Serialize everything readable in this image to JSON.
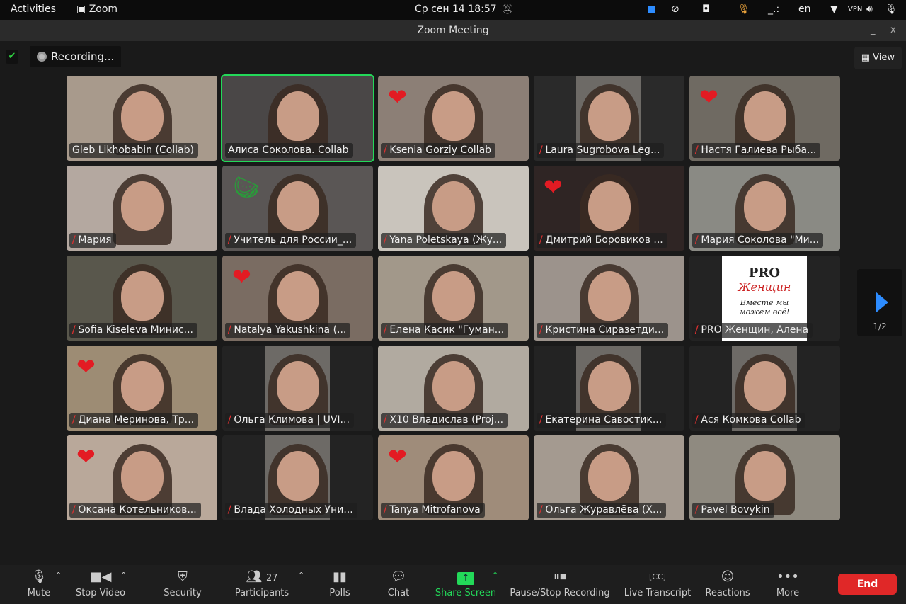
{
  "system_bar": {
    "activities": "Activities",
    "app": "Zoom",
    "datetime": "Ср сен 14  18:57",
    "lang": "en"
  },
  "window": {
    "title": "Zoom Meeting",
    "minimize": "_",
    "close": "x"
  },
  "meeting": {
    "recording": "Recording...",
    "view": "View",
    "page": "1/2"
  },
  "participants": [
    {
      "name": "Gleb Likhobabin (Collab)",
      "muted": false,
      "heart": false,
      "bg": "#a89a8c"
    },
    {
      "name": "Алиса Соколова. Collab",
      "muted": false,
      "heart": false,
      "bg": "#4a4747",
      "active": true
    },
    {
      "name": "Ksenia Gorziy Collab",
      "muted": true,
      "heart": true,
      "bg": "#8c7f76"
    },
    {
      "name": "Laura Sugrobova Leg...",
      "muted": true,
      "heart": false,
      "bg": "#2a2a2a"
    },
    {
      "name": "Настя Галиева Рыба...",
      "muted": true,
      "heart": true,
      "bg": "#6f6a62"
    },
    {
      "name": "Мария",
      "muted": true,
      "heart": false,
      "bg": "#b4a8a0"
    },
    {
      "name": "Учитель для России_...",
      "muted": true,
      "heart": false,
      "watermelon": true,
      "bg": "#5a5655"
    },
    {
      "name": "Yana Poletskaya (Жу...",
      "muted": true,
      "heart": false,
      "bg": "#c9c4bc"
    },
    {
      "name": "Дмитрий Боровиков ...",
      "muted": true,
      "heart": true,
      "bg": "#2f2524"
    },
    {
      "name": "Мария Соколова \"Ми...",
      "muted": true,
      "heart": false,
      "bg": "#8a8a84"
    },
    {
      "name": "Sofia Kiseleva Минис...",
      "muted": true,
      "heart": false,
      "bg": "#59574c"
    },
    {
      "name": "Natalya Yakushkina (...",
      "muted": true,
      "heart": true,
      "bg": "#7a6c62"
    },
    {
      "name": "Елена Касик \"Гуман...",
      "muted": true,
      "heart": false,
      "bg": "#a2988a"
    },
    {
      "name": "Кристина Сиразетди...",
      "muted": true,
      "heart": false,
      "bg": "#9c938c"
    },
    {
      "name": "PRO Женщин, Алена",
      "muted": true,
      "heart": false,
      "bg": "#232323",
      "logo": true
    },
    {
      "name": "Диана Меринова, Тр...",
      "muted": true,
      "heart": true,
      "bg": "#9d8c74"
    },
    {
      "name": "Ольга Климова | UVI...",
      "muted": true,
      "heart": false,
      "bg": "#232323"
    },
    {
      "name": "X10 Владислав (Proj...",
      "muted": true,
      "heart": false,
      "bg": "#b1aaa0"
    },
    {
      "name": "Екатерина Савостик...",
      "muted": true,
      "heart": false,
      "bg": "#232323"
    },
    {
      "name": "Ася Комкова Collab",
      "muted": true,
      "heart": false,
      "bg": "#232323"
    },
    {
      "name": "Оксана Котельников...",
      "muted": true,
      "heart": true,
      "bg": "#b9a89a"
    },
    {
      "name": "Влада Холодных Уни...",
      "muted": true,
      "heart": false,
      "bg": "#232323"
    },
    {
      "name": "Tanya Mitrofanova",
      "muted": true,
      "heart": true,
      "bg": "#9f8c7a"
    },
    {
      "name": "Ольга Журавлёва (Х...",
      "muted": true,
      "heart": false,
      "bg": "#a49a90"
    },
    {
      "name": "Pavel Bovykin",
      "muted": true,
      "heart": false,
      "bg": "#8f8a80"
    }
  ],
  "logo_text": {
    "line1": "PRO",
    "line2": "Женщин",
    "line3": "Вместе мы можем всё!"
  },
  "toolbar": {
    "mute": "Mute",
    "stop_video": "Stop Video",
    "security": "Security",
    "participants": "Participants",
    "participant_count": "27",
    "polls": "Polls",
    "chat": "Chat",
    "share_screen": "Share Screen",
    "recording": "Pause/Stop Recording",
    "transcript": "Live Transcript",
    "reactions": "Reactions",
    "more": "More",
    "end": "End"
  },
  "colors": {
    "accent_green": "#23d959",
    "end_red": "#e02828",
    "muted_red": "#e03030",
    "heart": "#e31b23",
    "zoom_blue": "#2d8cff"
  }
}
